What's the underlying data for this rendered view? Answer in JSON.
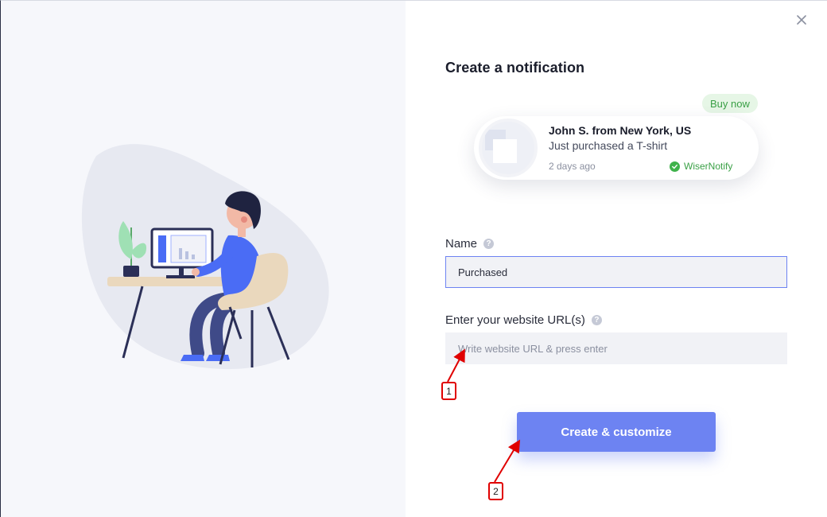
{
  "dialog": {
    "title": "Create a notification",
    "close_icon": "close-icon"
  },
  "preview": {
    "badge": "Buy now",
    "name": "John S. from New York, US",
    "action": "Just purchased a T-shirt",
    "time": "2 days ago",
    "brand": "WiserNotify",
    "brand_icon": "check-circle-icon"
  },
  "form": {
    "name_label": "Name",
    "name_value": "Purchased",
    "url_label": "Enter your website URL(s)",
    "url_placeholder": "Write website URL & press enter",
    "submit_label": "Create & customize"
  },
  "annotations": {
    "marker_1": "1",
    "marker_2": "2"
  },
  "colors": {
    "accent": "#6d83f2",
    "success": "#3fb24b",
    "annotation": "#e00000"
  }
}
